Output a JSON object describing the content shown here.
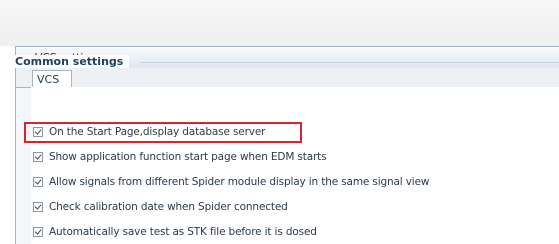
{
  "window": {
    "title": "VCS settings",
    "tab_label": "VCS"
  },
  "group": {
    "header": "Common settings"
  },
  "options": [
    {
      "label": "On the Start Page,display database server",
      "checked": true,
      "highlighted": true
    },
    {
      "label": "Show application function start page when EDM starts",
      "checked": true
    },
    {
      "label": "Allow signals from different Spider module display in the same signal view",
      "checked": true
    },
    {
      "label": "Check calibration date when Spider connected",
      "checked": true
    },
    {
      "label": "Automatically save test as STK file before it is dosed",
      "checked": true
    }
  ],
  "colors": {
    "highlight_border": "#d9232d",
    "group_header": "#1e3f66"
  }
}
